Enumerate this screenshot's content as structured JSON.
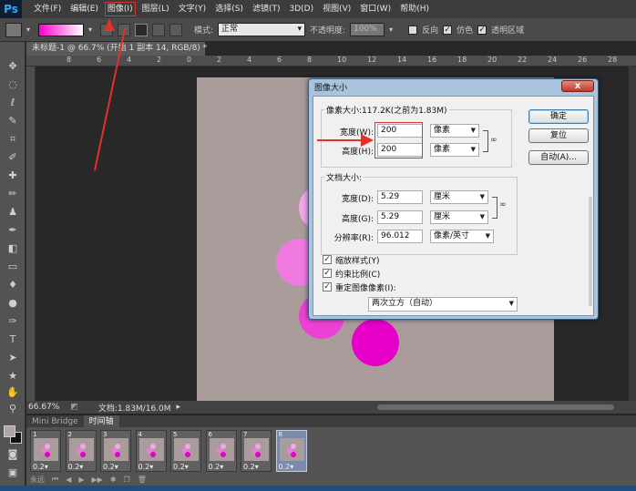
{
  "app": {
    "logo": "Ps"
  },
  "menu": [
    {
      "label": "文件(F)"
    },
    {
      "label": "编辑(E)"
    },
    {
      "label": "图像(I)",
      "highlighted": true
    },
    {
      "label": "图层(L)"
    },
    {
      "label": "文字(Y)"
    },
    {
      "label": "选择(S)"
    },
    {
      "label": "滤镜(T)"
    },
    {
      "label": "3D(D)"
    },
    {
      "label": "视图(V)"
    },
    {
      "label": "窗口(W)"
    },
    {
      "label": "帮助(H)"
    }
  ],
  "options": {
    "mode_label": "模式:",
    "mode_value": "正常",
    "opacity_label": "不透明度:",
    "opacity_value": "100%",
    "reverse_label": "反向",
    "dither_label": "仿色",
    "transparency_label": "透明区域",
    "gradient_colors": [
      "#ff00cc",
      "#ffffff"
    ]
  },
  "document": {
    "tab_title": "未标题-1 @ 66.7% (开始 1 副本 14, RGB/8) *",
    "ruler_numbers": [
      "8",
      "6",
      "4",
      "2",
      "0",
      "2",
      "4",
      "6",
      "8",
      "10",
      "12",
      "14",
      "16",
      "18",
      "20",
      "22",
      "24",
      "26",
      "28"
    ],
    "canvas_color": "#ab9c9c"
  },
  "status": {
    "zoom": "66.67%",
    "doc_info": "文档:1.83M/16.0M"
  },
  "panel": {
    "tabs": [
      {
        "label": "Mini Bridge",
        "active": false
      },
      {
        "label": "时间轴",
        "active": true
      }
    ],
    "frames": [
      {
        "num": "1",
        "delay": "0.2▾"
      },
      {
        "num": "2",
        "delay": "0.2▾"
      },
      {
        "num": "3",
        "delay": "0.2▾"
      },
      {
        "num": "4",
        "delay": "0.2▾"
      },
      {
        "num": "5",
        "delay": "0.2▾"
      },
      {
        "num": "6",
        "delay": "0.2▾"
      },
      {
        "num": "7",
        "delay": "0.2▾"
      },
      {
        "num": "8",
        "delay": "0.2▾",
        "selected": true
      }
    ],
    "loop_label": "永远"
  },
  "dialog": {
    "title": "图像大小",
    "close": "x",
    "pixel_dims_label": "像素大小:117.2K(之前为1.83M)",
    "width_label": "宽度(W):",
    "width_value": "200",
    "width_unit": "像素",
    "height_label": "高度(H):",
    "height_value": "200",
    "height_unit": "像素",
    "doc_size_label": "文档大小:",
    "doc_width_label": "宽度(D):",
    "doc_width_value": "5.29",
    "doc_width_unit": "厘米",
    "doc_height_label": "高度(G):",
    "doc_height_value": "5.29",
    "doc_height_unit": "厘米",
    "resolution_label": "分辨率(R):",
    "resolution_value": "96.012",
    "resolution_unit": "像素/英寸",
    "scale_styles_label": "缩放样式(Y)",
    "constrain_label": "约束比例(C)",
    "resample_label": "重定图像像素(I):",
    "resample_method": "两次立方（自动）",
    "ok_label": "确定",
    "reset_label": "复位",
    "auto_label": "自动(A)..."
  },
  "colors": {
    "annotation_red": "#e0322b",
    "petal_magenta": "#e600c8",
    "petal_light": "#f07ae0"
  }
}
